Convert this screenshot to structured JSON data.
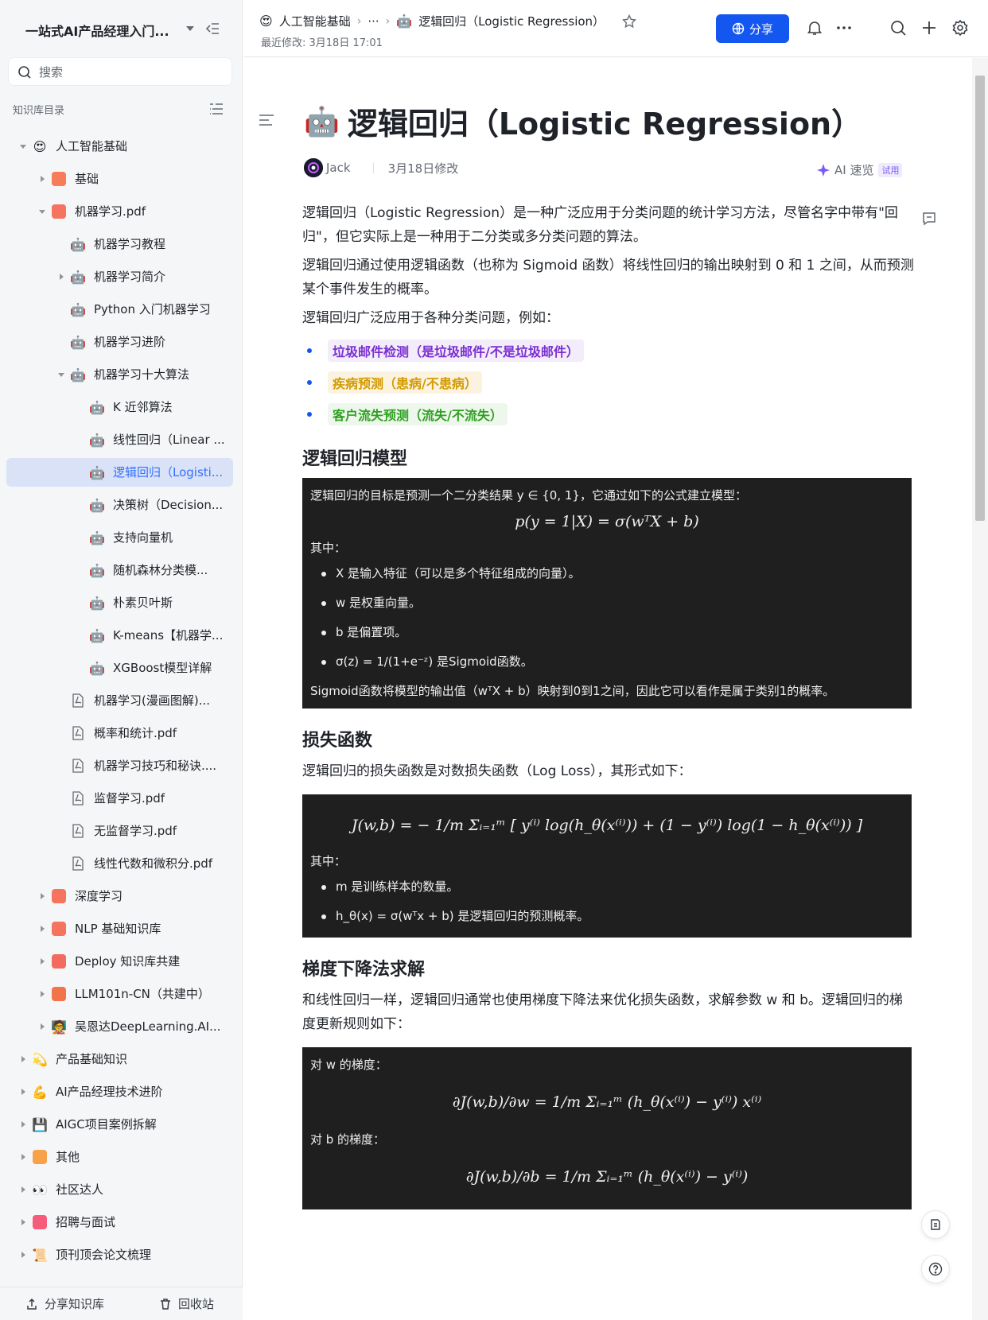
{
  "sidebar": {
    "title": "一站式AI产品经理入门...",
    "search_placeholder": "搜索",
    "section_label": "知识库目录",
    "nodes": [
      {
        "label": "人工智能基础",
        "level": 0,
        "arrow": "down",
        "icon": "smile-heart-icon"
      },
      {
        "label": "基础",
        "level": 1,
        "arrow": "right",
        "icon": "grid-icon"
      },
      {
        "label": "机器学习.pdf",
        "level": 1,
        "arrow": "down",
        "icon": "book-icon"
      },
      {
        "label": "机器学习教程",
        "level": 2,
        "arrow": "none",
        "icon": "robot-icon"
      },
      {
        "label": "机器学习简介",
        "level": 2,
        "arrow": "right",
        "icon": "robot-icon"
      },
      {
        "label": "Python 入门机器学习",
        "level": 2,
        "arrow": "none",
        "icon": "robot-icon"
      },
      {
        "label": "机器学习进阶",
        "level": 2,
        "arrow": "none",
        "icon": "robot-icon"
      },
      {
        "label": "机器学习十大算法",
        "level": 2,
        "arrow": "down",
        "icon": "robot-icon"
      },
      {
        "label": "K 近邻算法",
        "level": 3,
        "arrow": "none",
        "icon": "robot-icon"
      },
      {
        "label": "线性回归（Linear ...",
        "level": 3,
        "arrow": "none",
        "icon": "robot-icon"
      },
      {
        "label": "逻辑回归（Logisti...",
        "level": 3,
        "arrow": "none",
        "icon": "robot-icon",
        "active": true
      },
      {
        "label": "决策树（Decision...",
        "level": 3,
        "arrow": "none",
        "icon": "robot-icon"
      },
      {
        "label": "支持向量机",
        "level": 3,
        "arrow": "none",
        "icon": "robot-icon"
      },
      {
        "label": "随机森林分类模...",
        "level": 3,
        "arrow": "none",
        "icon": "robot-icon"
      },
      {
        "label": "朴素贝叶斯",
        "level": 3,
        "arrow": "none",
        "icon": "robot-icon"
      },
      {
        "label": "K-means【机器学...",
        "level": 3,
        "arrow": "none",
        "icon": "robot-icon"
      },
      {
        "label": "XGBoost模型详解",
        "level": 3,
        "arrow": "none",
        "icon": "robot-icon"
      },
      {
        "label": "机器学习(漫画图解)...",
        "level": 2,
        "arrow": "none",
        "icon": "pdf-icon"
      },
      {
        "label": "概率和统计.pdf",
        "level": 2,
        "arrow": "none",
        "icon": "pdf-icon"
      },
      {
        "label": "机器学习技巧和秘诀....",
        "level": 2,
        "arrow": "none",
        "icon": "pdf-icon"
      },
      {
        "label": "监督学习.pdf",
        "level": 2,
        "arrow": "none",
        "icon": "pdf-icon"
      },
      {
        "label": "无监督学习.pdf",
        "level": 2,
        "arrow": "none",
        "icon": "pdf-icon"
      },
      {
        "label": "线性代数和微积分.pdf",
        "level": 2,
        "arrow": "none",
        "icon": "pdf-icon"
      },
      {
        "label": "深度学习",
        "level": 1,
        "arrow": "right",
        "icon": "book-icon"
      },
      {
        "label": "NLP 基础知识库",
        "level": 1,
        "arrow": "right",
        "icon": "book-icon"
      },
      {
        "label": "Deploy 知识库共建",
        "level": 1,
        "arrow": "right",
        "icon": "chart-icon"
      },
      {
        "label": "LLM101n-CN（共建中）",
        "level": 1,
        "arrow": "right",
        "icon": "screen-icon"
      },
      {
        "label": "吴恩达DeepLearning.AI...",
        "level": 1,
        "arrow": "right",
        "icon": "person-icon"
      },
      {
        "label": "产品基础知识",
        "level": 0,
        "arrow": "right",
        "icon": "dizzy-icon"
      },
      {
        "label": "AI产品经理技术进阶",
        "level": 0,
        "arrow": "right",
        "icon": "muscle-icon"
      },
      {
        "label": "AIGC项目案例拆解",
        "level": 0,
        "arrow": "right",
        "icon": "floppy-icon"
      },
      {
        "label": "其他",
        "level": 0,
        "arrow": "right",
        "icon": "box-icon"
      },
      {
        "label": "社区达人",
        "level": 0,
        "arrow": "right",
        "icon": "eyes-icon"
      },
      {
        "label": "招聘与面试",
        "level": 0,
        "arrow": "right",
        "icon": "mail-icon"
      },
      {
        "label": "顶刊顶会论文梳理",
        "level": 0,
        "arrow": "right",
        "icon": "scroll-icon"
      }
    ],
    "footer": {
      "share_label": "分享知识库",
      "trash_label": "回收站"
    }
  },
  "header": {
    "crumb_root": "人工智能基础",
    "crumb_more": "···",
    "crumb_current": "逻辑回归（Logistic Regression）",
    "updated": "最近修改: 3月18日 17:01",
    "share_label": "分享"
  },
  "doc": {
    "title": "逻辑回归（Logistic Regression）",
    "author": "Jack",
    "modified": "3月18日修改",
    "ai_label": "AI 速览",
    "ai_trial": "试用",
    "p1": "逻辑回归（Logistic Regression）是一种广泛应用于分类问题的统计学习方法，尽管名字中带有\"回归\"，但它实际上是一种用于二分类或多分类问题的算法。",
    "p2": "逻辑回归通过使用逻辑函数（也称为 Sigmoid 函数）将线性回归的输出映射到 0 和 1 之间，从而预测某个事件发生的概率。",
    "p3": "逻辑回归广泛应用于各种分类问题，例如：",
    "highlights": [
      {
        "text": "垃圾邮件检测（是垃圾邮件/不是垃圾邮件）",
        "color": "#7b2fd0",
        "bg": "#f2ecfb"
      },
      {
        "text": "疾病预测（患病/不患病）",
        "color": "#d49a00",
        "bg": "#fbf3e0"
      },
      {
        "text": "客户流失预测（流失/不流失）",
        "color": "#2ea121",
        "bg": "#eef7ec"
      }
    ],
    "h_model": "逻辑回归模型",
    "model_intro": "逻辑回归的目标是预测一个二分类结果 y ∈ {0, 1}，它通过如下的公式建立模型：",
    "model_formula": "p(y = 1|X) = σ(wᵀX + b)",
    "where_label": "其中：",
    "model_items": [
      "X 是输入特征（可以是多个特征组成的向量）。",
      "w 是权重向量。",
      "b 是偏置项。",
      "σ(z) = 1/(1+e⁻ᶻ) 是Sigmoid函数。"
    ],
    "model_note": "Sigmoid函数将模型的输出值（wᵀX + b）映射到0到1之间，因此它可以看作是属于类别1的概率。",
    "h_loss": "损失函数",
    "loss_intro": "逻辑回归的损失函数是对数损失函数（Log Loss），其形式如下：",
    "loss_formula": "J(w,b) = − 1/m Σᵢ₌₁ᵐ [ y⁽ⁱ⁾ log(h_θ(x⁽ⁱ⁾)) + (1 − y⁽ⁱ⁾) log(1 − h_θ(x⁽ⁱ⁾)) ]",
    "loss_where": "其中：",
    "loss_items": [
      "m 是训练样本的数量。",
      "h_θ(x) = σ(wᵀx + b) 是逻辑回归的预测概率。"
    ],
    "h_gd": "梯度下降法求解",
    "gd_intro": "和线性回归一样，逻辑回归通常也使用梯度下降法来优化损失函数，求解参数 w 和 b。逻辑回归的梯度更新规则如下：",
    "gd_w_label": "对 w 的梯度：",
    "gd_w_formula": "∂J(w,b)/∂w = 1/m Σᵢ₌₁ᵐ (h_θ(x⁽ⁱ⁾) − y⁽ⁱ⁾) x⁽ⁱ⁾",
    "gd_b_label": "对 b 的梯度：",
    "gd_b_formula": "∂J(w,b)/∂b = 1/m Σᵢ₌₁ᵐ (h_θ(x⁽ⁱ⁾) − y⁽ⁱ⁾)"
  }
}
